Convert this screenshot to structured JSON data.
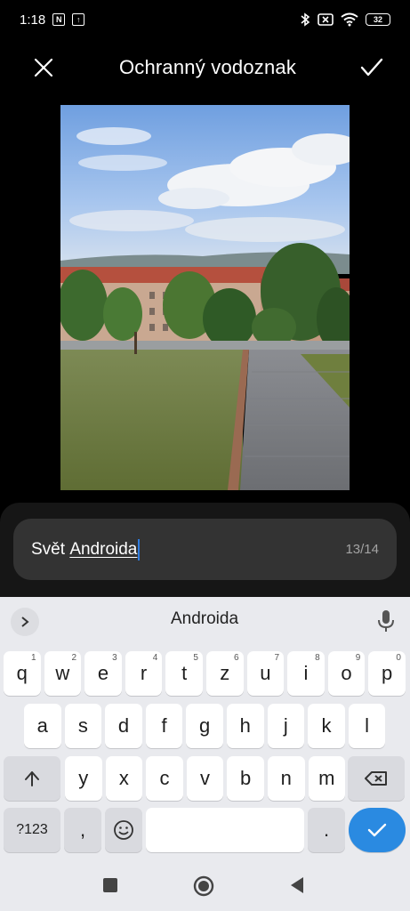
{
  "status_bar": {
    "time": "1:18",
    "nfc_icon": "N",
    "upload_icon": "↑",
    "battery_level": "32"
  },
  "header": {
    "title": "Ochranný vodoznak"
  },
  "text_input": {
    "prefix": "Svět ",
    "composing": "Androida",
    "counter": "13/14"
  },
  "keyboard": {
    "suggestion": "Androida",
    "rows": [
      [
        {
          "k": "q",
          "h": "1"
        },
        {
          "k": "w",
          "h": "2"
        },
        {
          "k": "e",
          "h": "3"
        },
        {
          "k": "r",
          "h": "4"
        },
        {
          "k": "t",
          "h": "5"
        },
        {
          "k": "z",
          "h": "6"
        },
        {
          "k": "u",
          "h": "7"
        },
        {
          "k": "i",
          "h": "8"
        },
        {
          "k": "o",
          "h": "9"
        },
        {
          "k": "p",
          "h": "0"
        }
      ],
      [
        {
          "k": "a"
        },
        {
          "k": "s"
        },
        {
          "k": "d"
        },
        {
          "k": "f"
        },
        {
          "k": "g"
        },
        {
          "k": "h"
        },
        {
          "k": "j"
        },
        {
          "k": "k"
        },
        {
          "k": "l"
        }
      ],
      [
        {
          "k": "y"
        },
        {
          "k": "x"
        },
        {
          "k": "c"
        },
        {
          "k": "v"
        },
        {
          "k": "b"
        },
        {
          "k": "n"
        },
        {
          "k": "m"
        }
      ]
    ],
    "symbols_label": "?123",
    "comma_label": ",",
    "period_label": "."
  },
  "colors": {
    "accent": "#2a8ae1",
    "cursor": "#2f7de1"
  }
}
